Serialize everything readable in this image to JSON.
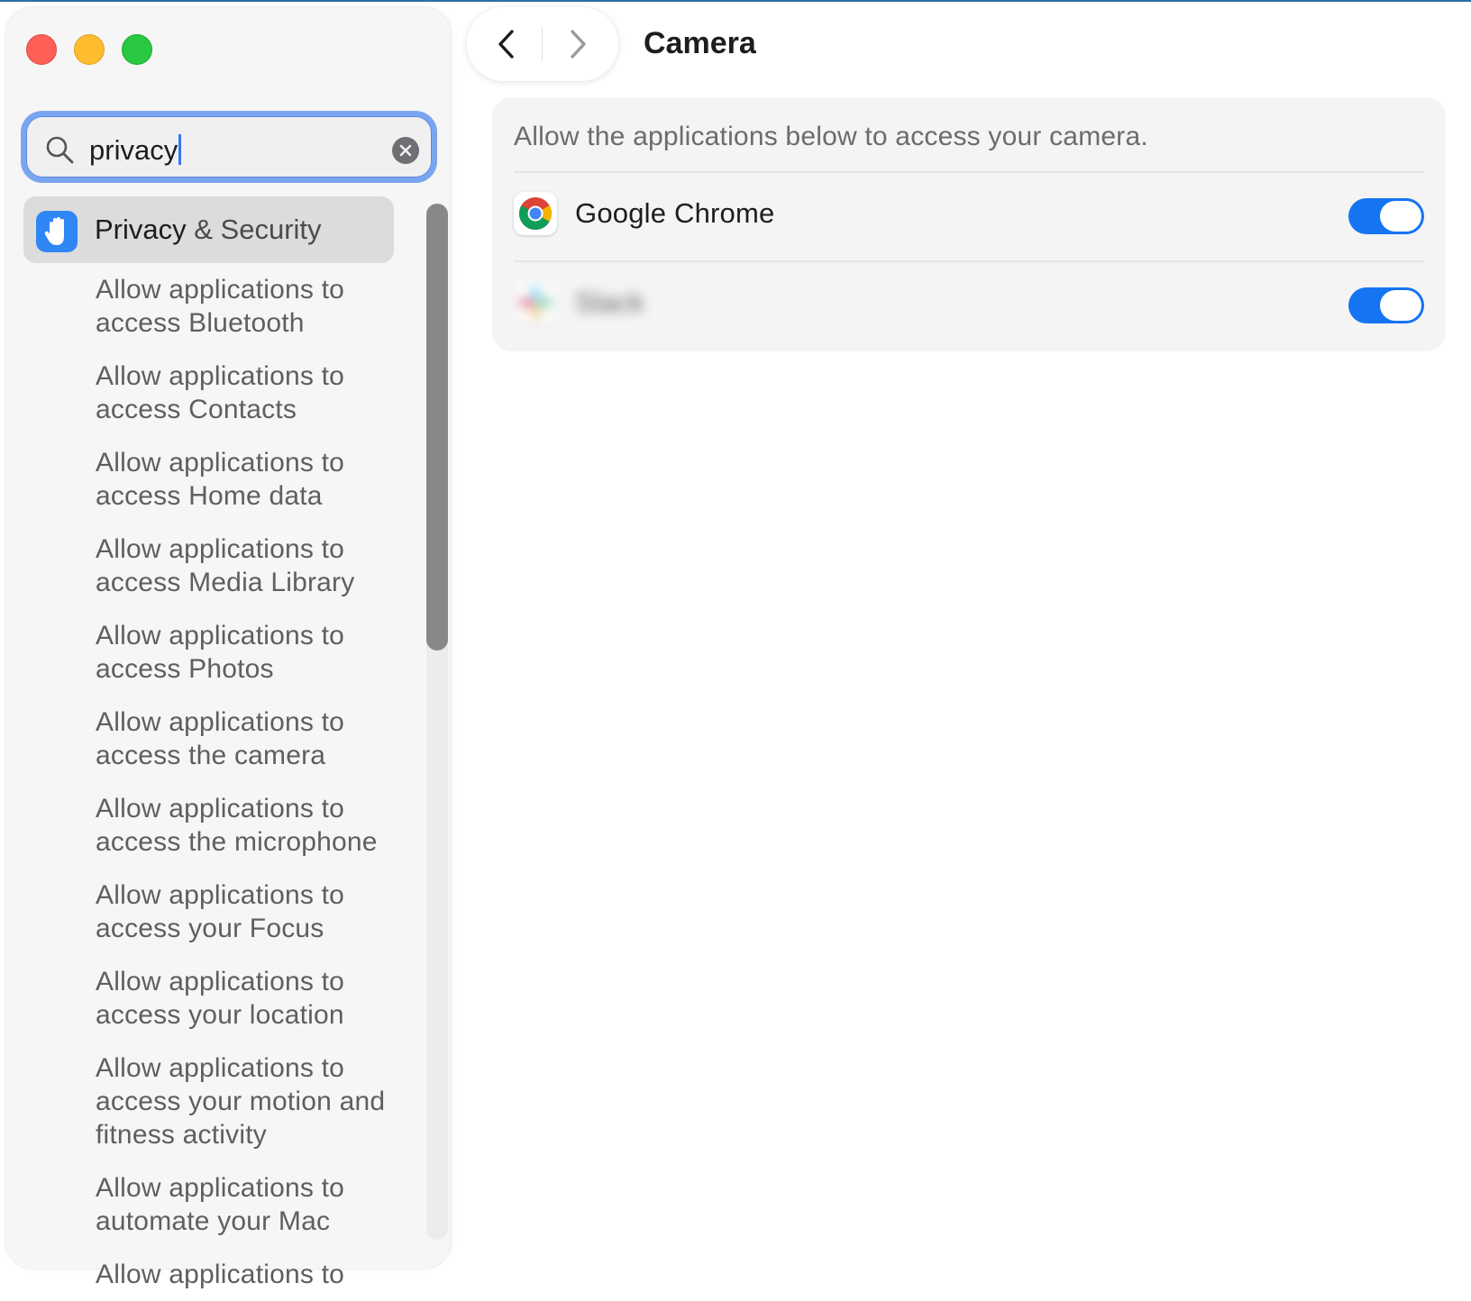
{
  "window": {
    "controls": [
      {
        "name": "close-button",
        "color": "#fe5f57"
      },
      {
        "name": "minimize-button",
        "color": "#febc2e"
      },
      {
        "name": "zoom-button",
        "color": "#28c840"
      }
    ]
  },
  "search": {
    "value": "privacy",
    "icon": "search-icon",
    "clear_icon": "clear-icon"
  },
  "sidebar": {
    "selected": {
      "label_strong": "Privacy",
      "label_rest": " & Security",
      "icon": "raised-hand-icon",
      "icon_color": "#2f86f5"
    },
    "items": [
      "Allow applications to access Bluetooth",
      "Allow applications to access Contacts",
      "Allow applications to access Home data",
      "Allow applications to access Media Library",
      "Allow applications to access Photos",
      "Allow applications to access the camera",
      "Allow applications to access the microphone",
      "Allow applications to access your Focus",
      "Allow applications to access your location",
      "Allow applications to access your motion and fitness activity",
      "Allow applications to automate your Mac",
      "Allow applications to"
    ]
  },
  "toolbar": {
    "back_icon": "chevron-left-icon",
    "forward_icon": "chevron-right-icon",
    "title": "Camera"
  },
  "panel": {
    "description": "Allow the applications below to access your camera.",
    "apps": [
      {
        "name": "Google Chrome",
        "icon": "chrome-icon",
        "enabled": true
      },
      {
        "name": "Slack",
        "icon": "slack-icon",
        "enabled": true,
        "blurred": true
      }
    ],
    "accent": "#1574f2"
  }
}
